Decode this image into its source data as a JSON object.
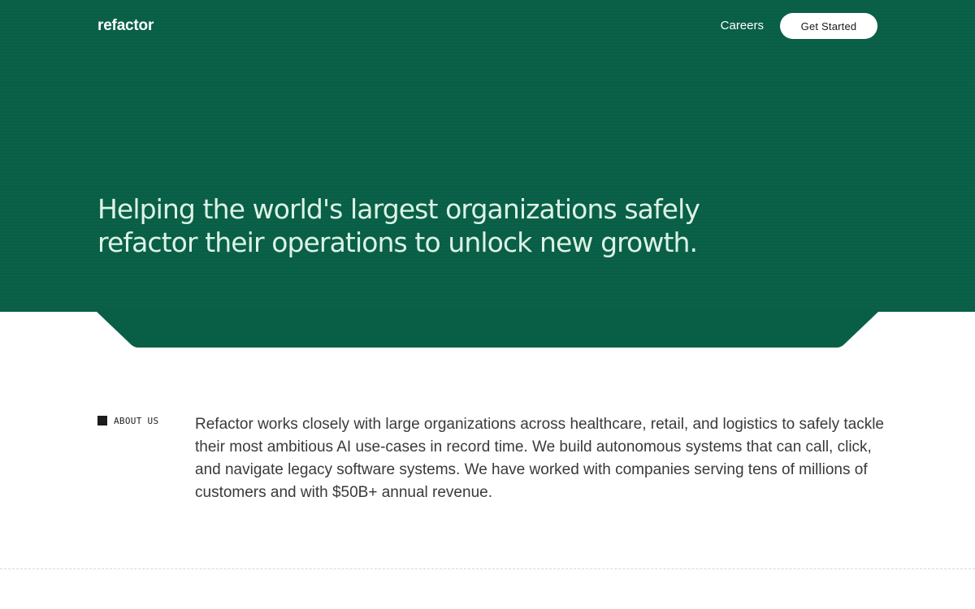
{
  "header": {
    "logo": "refactor",
    "nav_careers": "Careers",
    "cta_label": "Get Started"
  },
  "hero": {
    "headline": "Helping the world's largest organizations safely refactor their operations to unlock new growth."
  },
  "about": {
    "label": "ABOUT US",
    "body": "Refactor works closely with large organizations across healthcare, retail, and logistics to safely tackle their most ambitious AI use-cases in record time. We build autonomous systems that can call, click, and navigate legacy software systems. We have worked with companies serving tens of millions of customers and with $50B+ annual revenue."
  },
  "colors": {
    "hero_green": "#085F46",
    "headline_mint": "#DDF3E6",
    "body_text": "#3A3A3A"
  }
}
